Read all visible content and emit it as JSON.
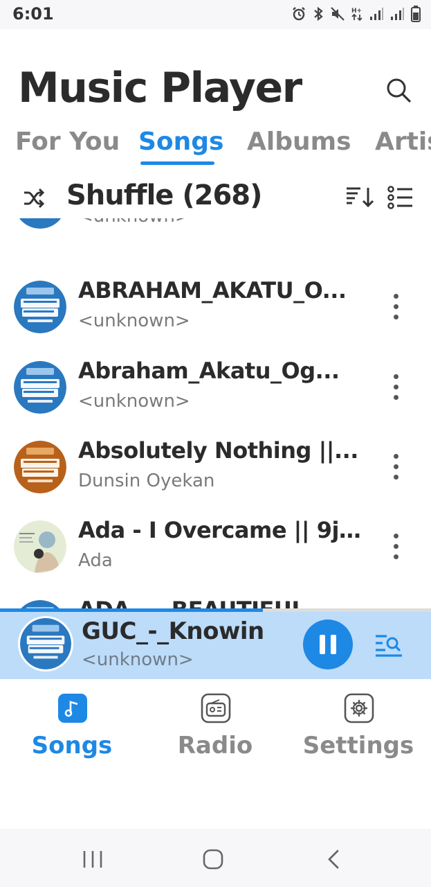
{
  "status_bar": {
    "time": "6:01"
  },
  "header": {
    "title": "Music Player"
  },
  "tabs": [
    {
      "label": "For You"
    },
    {
      "label": "Songs",
      "active": true
    },
    {
      "label": "Albums"
    },
    {
      "label": "Artis"
    }
  ],
  "shuffle": {
    "label": "Shuffle",
    "count": "(268)"
  },
  "songs": [
    {
      "title": "",
      "artist": "<unknown>",
      "art": "gospel-jingle-blue"
    },
    {
      "title": "ABRAHAM_AKATU_O...",
      "artist": "<unknown>",
      "art": "gospel-jingle-blue"
    },
    {
      "title": "Abraham_Akatu_Og...",
      "artist": "<unknown>",
      "art": "gospel-jingle-blue"
    },
    {
      "title": "Absolutely Nothing ||...",
      "artist": "Dunsin Oyekan",
      "art": "gospel-jingle-orange"
    },
    {
      "title": "Ada - I Overcame || 9j...",
      "artist": "Ada",
      "art": "ada-portrait"
    },
    {
      "title": "ADA - _ BEAUTIFUL",
      "artist": "",
      "art": "gospel-jingle-blue"
    }
  ],
  "now_playing": {
    "title": "GUC_-_Knowin",
    "artist": "<unknown>",
    "progress": 0.61,
    "state": "playing"
  },
  "bottom_nav": [
    {
      "label": "Songs",
      "icon": "music-note-icon",
      "active": true
    },
    {
      "label": "Radio",
      "icon": "radio-icon"
    },
    {
      "label": "Settings",
      "icon": "settings-icon"
    }
  ],
  "colors": {
    "accent": "#1e88e5",
    "mini_player_bg": "#bcdcfa",
    "inactive_text": "#8a8a8a",
    "title_text": "#2b2b2b"
  }
}
